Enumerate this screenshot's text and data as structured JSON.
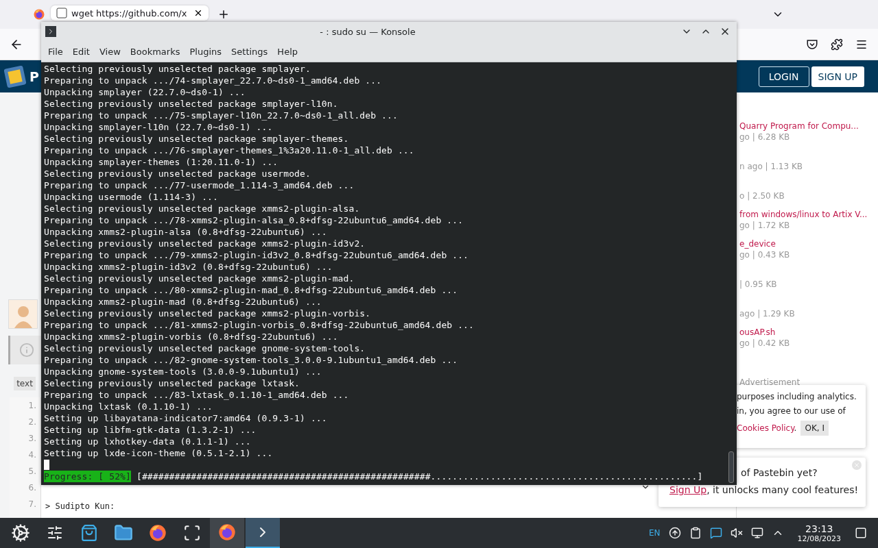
{
  "browser": {
    "tab": {
      "title": "wget https://github.com/x"
    },
    "site": {
      "logo_letter": "P",
      "login": "LOGIN",
      "signup": "SIGN UP"
    },
    "recent": [
      {
        "title": "Quarry Program for Compu...",
        "meta": "go | 6.28 KB"
      },
      {
        "meta": "n ago | 1.13 KB"
      },
      {
        "meta": "o | 2.50 KB"
      },
      {
        "title": "from windows/linux to Artix V...",
        "meta": "go | 1.72 KB"
      },
      {
        "title": "e_device",
        "meta": "go | 0.43 KB"
      },
      {
        "meta": "| 0.95 KB"
      },
      {
        "meta": "ago | 1.29 KB"
      },
      {
        "title": "ousAP.sh",
        "meta": "go | 0.42 KB"
      }
    ],
    "ad_label": "Advertisement",
    "cookie": {
      "lines": [
        "purposes including analytics.",
        "in, you agree to our use of"
      ],
      "link": "Cookies Policy",
      "after": ".",
      "button": "OK, I"
    },
    "toast": {
      "line1": "of Pastebin yet?",
      "link": "Sign Up",
      "line2": ", it unlocks many cool features!"
    },
    "syntax_tag": "text",
    "line_numbers": [
      "1.",
      "2.",
      "3.",
      "4.",
      "5.",
      "6.",
      "7."
    ],
    "comment_line": "> Sudipto Kun:"
  },
  "konsole": {
    "title": "- : sudo su — Konsole",
    "menu": [
      "File",
      "Edit",
      "View",
      "Bookmarks",
      "Plugins",
      "Settings",
      "Help"
    ],
    "lines": [
      "Selecting previously unselected package smplayer.",
      "Preparing to unpack .../74-smplayer_22.7.0~ds0-1_amd64.deb ...",
      "Unpacking smplayer (22.7.0~ds0-1) ...",
      "Selecting previously unselected package smplayer-l10n.",
      "Preparing to unpack .../75-smplayer-l10n_22.7.0~ds0-1_all.deb ...",
      "Unpacking smplayer-l10n (22.7.0~ds0-1) ...",
      "Selecting previously unselected package smplayer-themes.",
      "Preparing to unpack .../76-smplayer-themes_1%3a20.11.0-1_all.deb ...",
      "Unpacking smplayer-themes (1:20.11.0-1) ...",
      "Selecting previously unselected package usermode.",
      "Preparing to unpack .../77-usermode_1.114-3_amd64.deb ...",
      "Unpacking usermode (1.114-3) ...",
      "Selecting previously unselected package xmms2-plugin-alsa.",
      "Preparing to unpack .../78-xmms2-plugin-alsa_0.8+dfsg-22ubuntu6_amd64.deb ...",
      "Unpacking xmms2-plugin-alsa (0.8+dfsg-22ubuntu6) ...",
      "Selecting previously unselected package xmms2-plugin-id3v2.",
      "Preparing to unpack .../79-xmms2-plugin-id3v2_0.8+dfsg-22ubuntu6_amd64.deb ...",
      "Unpacking xmms2-plugin-id3v2 (0.8+dfsg-22ubuntu6) ...",
      "Selecting previously unselected package xmms2-plugin-mad.",
      "Preparing to unpack .../80-xmms2-plugin-mad_0.8+dfsg-22ubuntu6_amd64.deb ...",
      "Unpacking xmms2-plugin-mad (0.8+dfsg-22ubuntu6) ...",
      "Selecting previously unselected package xmms2-plugin-vorbis.",
      "Preparing to unpack .../81-xmms2-plugin-vorbis_0.8+dfsg-22ubuntu6_amd64.deb ...",
      "Unpacking xmms2-plugin-vorbis (0.8+dfsg-22ubuntu6) ...",
      "Selecting previously unselected package gnome-system-tools.",
      "Preparing to unpack .../82-gnome-system-tools_3.0.0-9.1ubuntu1_amd64.deb ...",
      "Unpacking gnome-system-tools (3.0.0-9.1ubuntu1) ...",
      "Selecting previously unselected package lxtask.",
      "Preparing to unpack .../83-lxtask_0.1.10-1_amd64.deb ...",
      "Unpacking lxtask (0.1.10-1) ...",
      "Setting up libayatana-indicator7:amd64 (0.9.3-1) ...",
      "Setting up libfm-gtk-data (1.3.2-1) ...",
      "Setting up lxhotkey-data (0.1.1-1) ...",
      "Setting up lxde-icon-theme (0.5.1-2.1) ..."
    ],
    "progress_label": "Progress: [ 52%]",
    "progress_bar": "[#####################################################.................................................]"
  },
  "taskbar": {
    "tasks": [
      {
        "selected": false
      },
      {
        "selected": true
      }
    ],
    "keyboard": "EN",
    "time": "23:13",
    "date": "12/08/2023"
  }
}
